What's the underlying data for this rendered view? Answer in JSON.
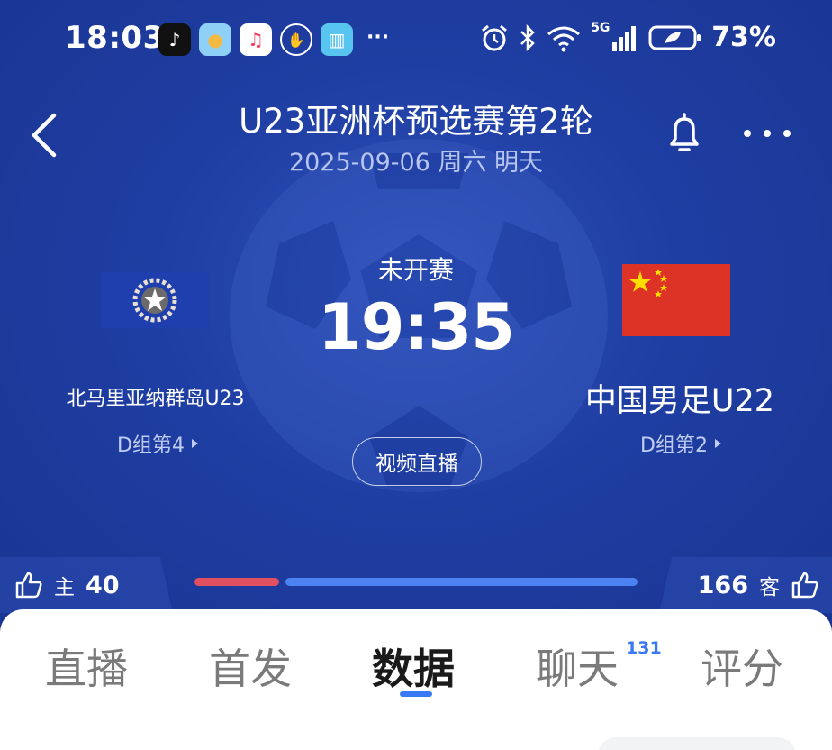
{
  "status_bar": {
    "time": "18:03",
    "app_icons": [
      "tiktok-icon",
      "weather-icon",
      "music-icon",
      "hand-icon",
      "book-icon"
    ],
    "network": "5G",
    "battery": "73%"
  },
  "header": {
    "title": "U23亚洲杯预选赛第2轮",
    "subtitle": "2025-09-06 周六 明天"
  },
  "match": {
    "status": "未开赛",
    "kickoff": "19:35",
    "video_button": "视频直播",
    "home": {
      "name": "北马里亚纳群岛U23",
      "rank": "D组第4"
    },
    "away": {
      "name": "中国男足U22",
      "rank": "D组第2"
    }
  },
  "likes": {
    "home_label": "主",
    "home_count": "40",
    "away_label": "客",
    "away_count": "166",
    "home_share": 0.194
  },
  "tabs": [
    {
      "label": "直播"
    },
    {
      "label": "首发"
    },
    {
      "label": "数据",
      "active": true
    },
    {
      "label": "聊天",
      "badge": "131"
    },
    {
      "label": "评分"
    }
  ],
  "colors": {
    "hero_bg": "#1f3ea3",
    "home_bar": "#e05060",
    "away_bar": "#4c82f2",
    "accent": "#3a79f5",
    "cn_flag": "#dc3326"
  }
}
